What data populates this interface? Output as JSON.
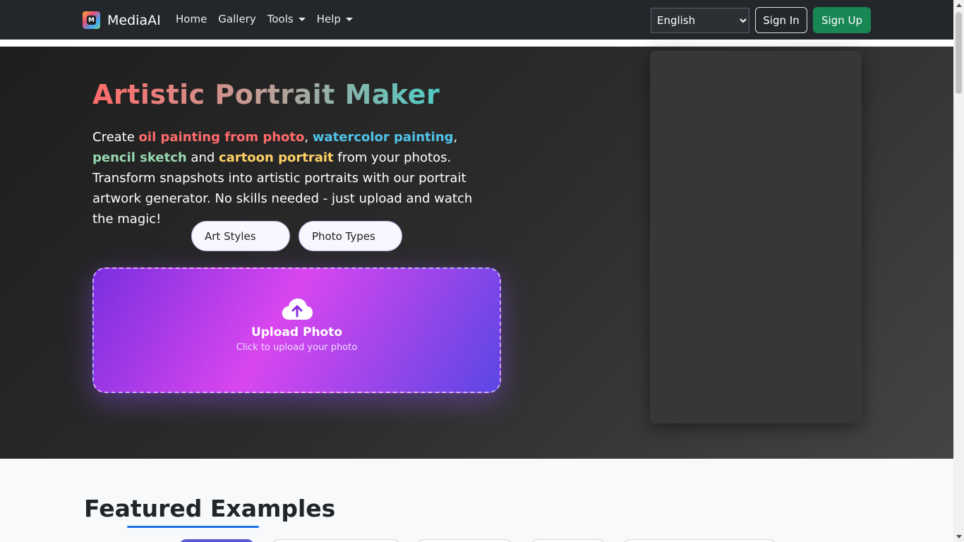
{
  "navbar": {
    "brand": "MediaAI",
    "links": {
      "home": "Home",
      "gallery": "Gallery",
      "tools": "Tools",
      "help": "Help"
    },
    "language": "English",
    "sign_in": "Sign In",
    "sign_up": "Sign Up"
  },
  "hero": {
    "title": "Artistic Portrait Maker",
    "desc": {
      "t1": "Create ",
      "oil": "oil painting from photo",
      "t2": ", ",
      "water": "watercolor painting",
      "t3": ", ",
      "pencil": "pencil sketch",
      "t4": " and ",
      "cartoon": "cartoon portrait",
      "t5": " from your photos. Transform snapshots into artistic portraits with our portrait artwork generator. No skills needed - just upload and watch the magic!"
    },
    "pill_art_styles": "Art Styles",
    "pill_photo_types": "Photo Types",
    "upload_title": "Upload Photo",
    "upload_sub": "Click to upload your photo"
  },
  "featured": {
    "title": "Featured Examples"
  },
  "colors": {
    "navbar_bg": "#23272b",
    "signup_bg": "#198754",
    "accent_blue": "#1a73e8",
    "upload_gradient_start": "#7a2fe0",
    "upload_gradient_mid": "#d946ef"
  },
  "icons": {
    "upload": "cloud-upload-icon",
    "caret": "caret-down-icon"
  }
}
